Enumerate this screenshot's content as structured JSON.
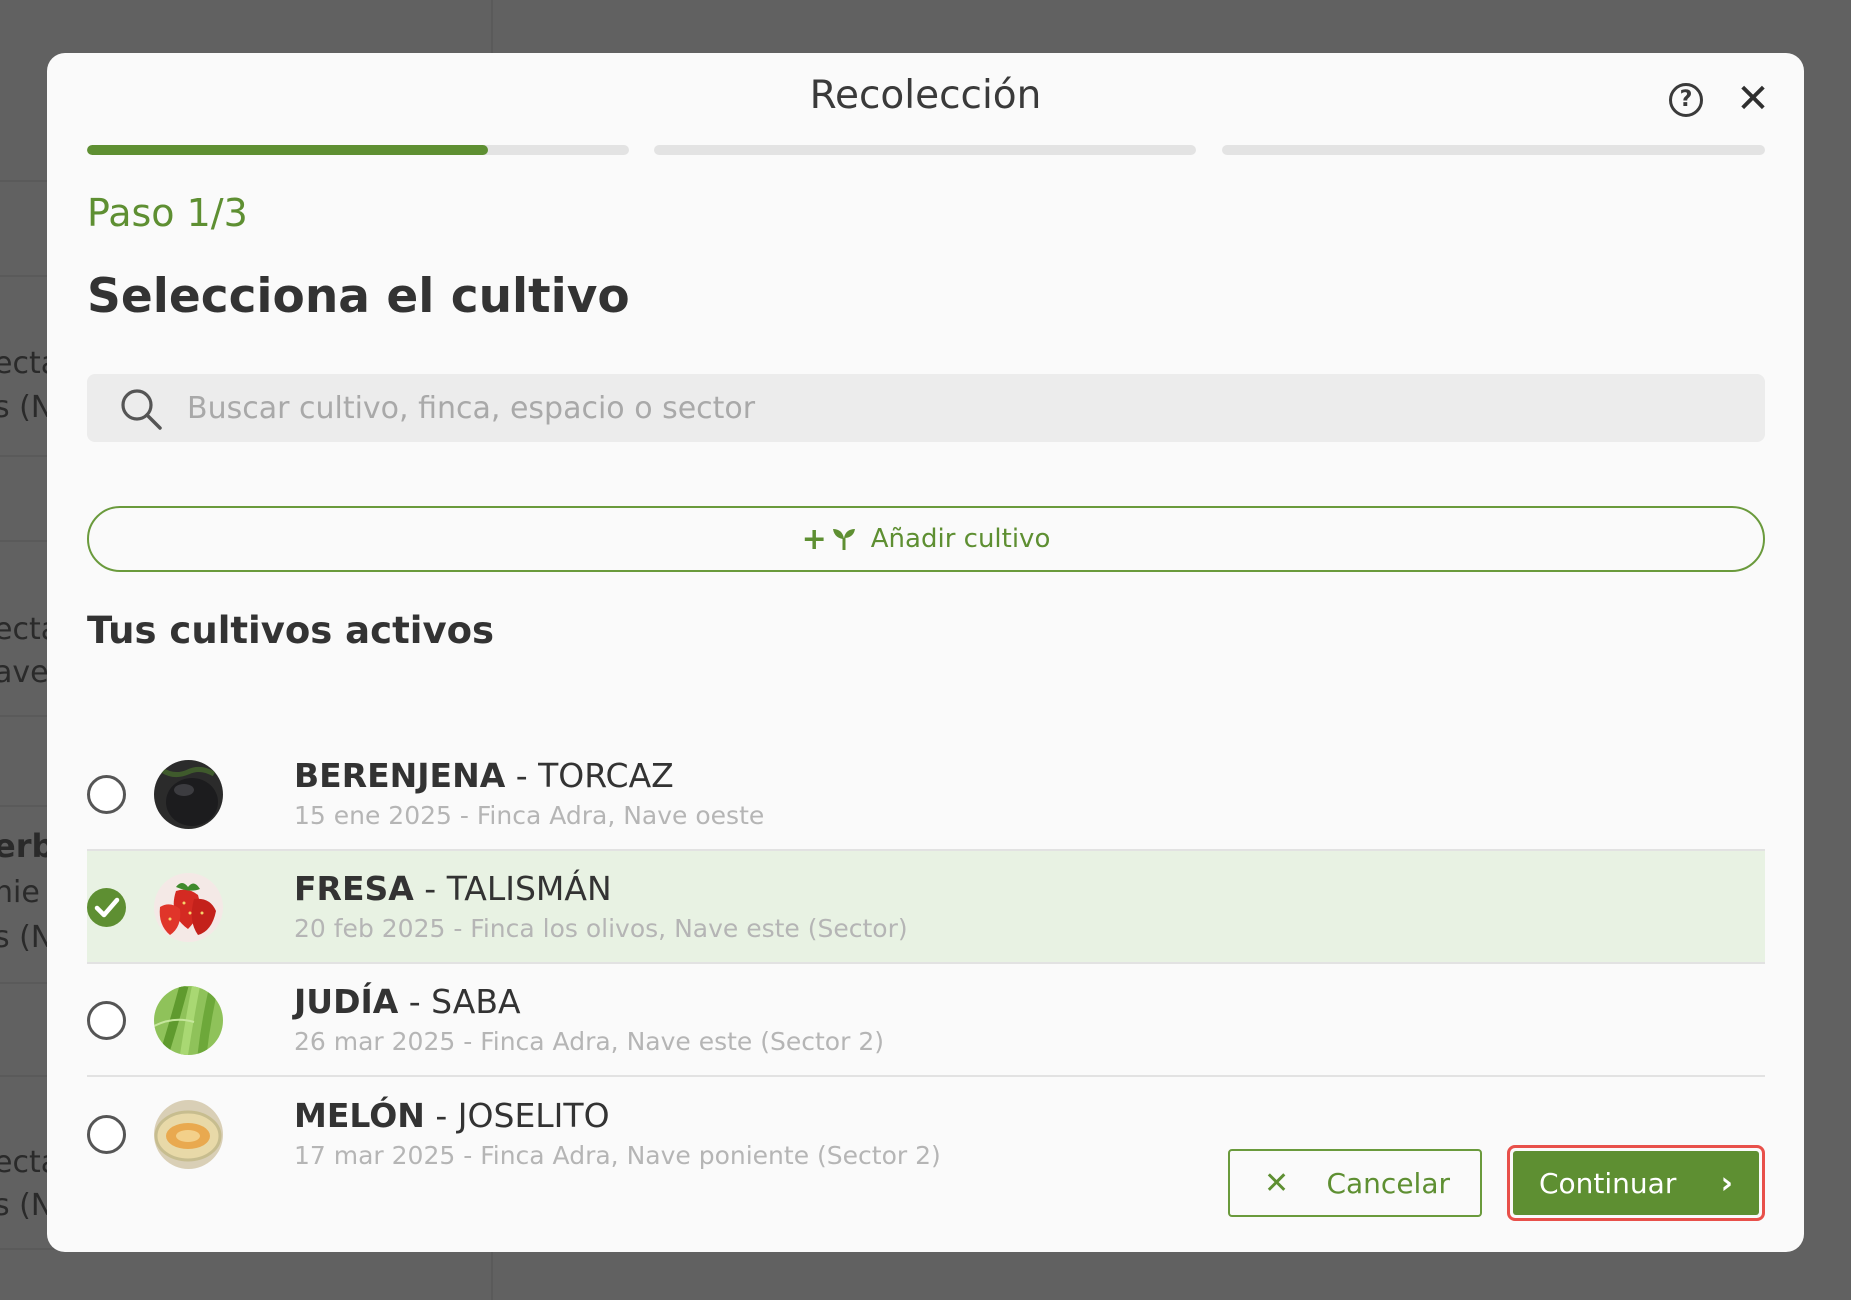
{
  "background": {
    "fragments": [
      "ecta",
      "s (N",
      "ecta",
      "ave",
      "erb",
      "hie",
      "s (N",
      "ecta",
      "s (N"
    ]
  },
  "modal": {
    "title": "Recolección",
    "progress": [
      0.74,
      0,
      0
    ],
    "step_label": "Paso 1/3",
    "heading": "Selecciona el cultivo",
    "search": {
      "placeholder": "Buscar cultivo, finca, espacio o sector",
      "value": ""
    },
    "add_button": {
      "plus": "+",
      "label": "Añadir cultivo"
    },
    "section_title": "Tus cultivos activos",
    "crops": [
      {
        "name": "BERENJENA",
        "variety": " - TORCAZ",
        "meta": "15 ene 2025 - Finca Adra, Nave oeste",
        "selected": false,
        "thumb_icon": "eggplant-image"
      },
      {
        "name": "FRESA",
        "variety": " - TALISMÁN",
        "meta": "20 feb 2025 - Finca los olivos, Nave este (Sector)",
        "selected": true,
        "thumb_icon": "strawberry-image"
      },
      {
        "name": "JUDÍA",
        "variety": " - SABA",
        "meta": "26 mar 2025 - Finca Adra, Nave este (Sector 2)",
        "selected": false,
        "thumb_icon": "green-bean-image"
      },
      {
        "name": "MELÓN",
        "variety": " - JOSELITO",
        "meta": "17 mar 2025 - Finca Adra, Nave poniente (Sector 2)",
        "selected": false,
        "thumb_icon": "melon-image"
      }
    ],
    "cancel_label": "Cancelar",
    "continue_label": "Continuar"
  },
  "colors": {
    "accent": "#5e8f32",
    "highlight": "#e8504a",
    "selected_row": "#e8f2e3"
  }
}
